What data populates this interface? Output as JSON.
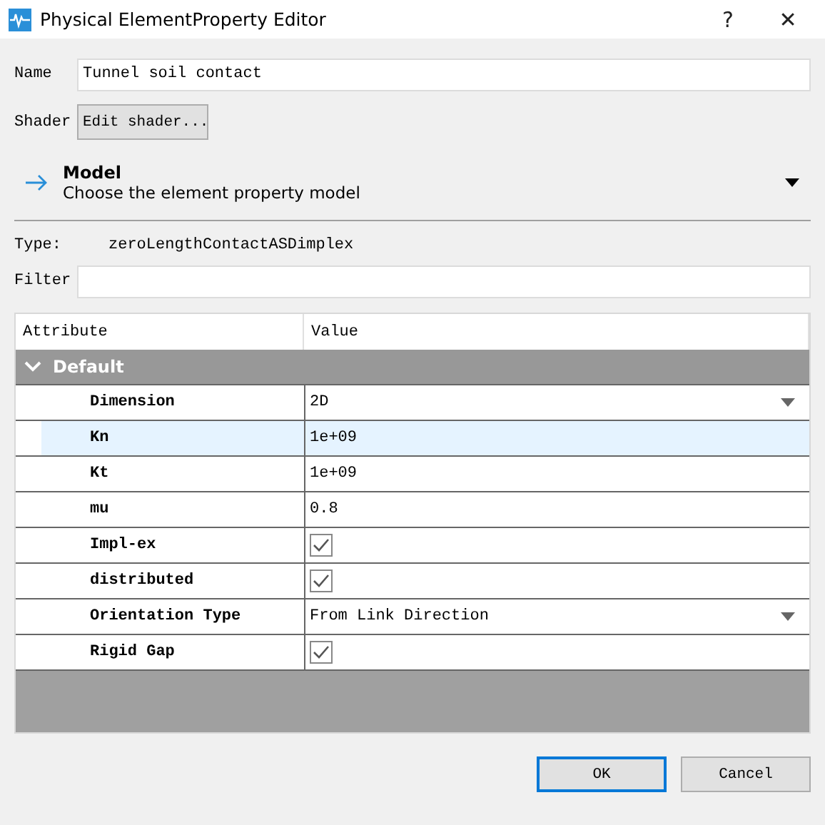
{
  "window": {
    "title": "Physical ElementProperty Editor",
    "help": "?",
    "close": "✕"
  },
  "name": {
    "label": "Name",
    "value": "Tunnel soil contact"
  },
  "shader": {
    "label": "Shader",
    "button": "Edit shader..."
  },
  "model": {
    "title": "Model",
    "subtitle": "Choose the element property model",
    "expanded": false
  },
  "type": {
    "label": "Type:",
    "value": "zeroLengthContactASDimplex"
  },
  "filter": {
    "label": "Filter"
  },
  "table": {
    "columns": [
      "Attribute",
      "Value"
    ],
    "group": {
      "label": "Default",
      "expanded": true
    },
    "rows": [
      {
        "attribute": "Dimension",
        "kind": "dropdown",
        "value": "2D",
        "selected": false
      },
      {
        "attribute": "Kn",
        "kind": "text",
        "value": "1e+09",
        "selected": true
      },
      {
        "attribute": "Kt",
        "kind": "text",
        "value": "1e+09",
        "selected": false
      },
      {
        "attribute": "mu",
        "kind": "text",
        "value": "0.8",
        "selected": false
      },
      {
        "attribute": "Impl-ex",
        "kind": "checkbox",
        "checked": true,
        "selected": false
      },
      {
        "attribute": "distributed",
        "kind": "checkbox",
        "checked": true,
        "selected": false
      },
      {
        "attribute": "Orientation Type",
        "kind": "dropdown",
        "value": "From Link Direction",
        "selected": false
      },
      {
        "attribute": "Rigid Gap",
        "kind": "checkbox",
        "checked": true,
        "selected": false
      }
    ]
  },
  "buttons": [
    {
      "label": "OK",
      "default": true
    },
    {
      "label": "Cancel",
      "default": false
    }
  ]
}
